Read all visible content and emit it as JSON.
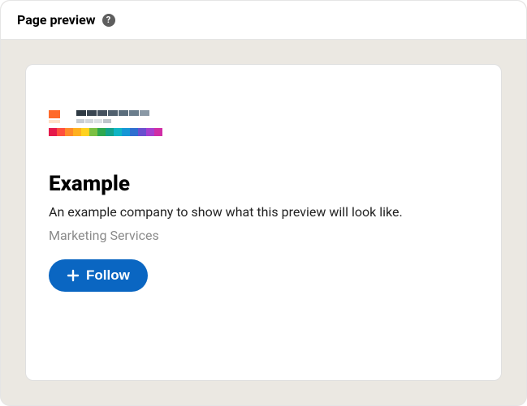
{
  "panel": {
    "title": "Page preview"
  },
  "preview": {
    "company_name": "Example",
    "tagline": "An example company to show what this preview will look like.",
    "industry": "Marketing Services",
    "follow_label": "Follow"
  },
  "logo": {
    "row1_left_a": "#ff6a2b",
    "row1_left_b": "#ffe1c8",
    "dark_palette": [
      "#2f3a44",
      "#3a4652",
      "#45525f",
      "#50606e",
      "#5a6d7c",
      "#6a7d8c",
      "#8a99a6"
    ],
    "grey_palette": [
      "#c7cdd3",
      "#d2d7dc",
      "#dde1e5",
      "#bfc5cb"
    ],
    "rainbow": [
      "#e5194b",
      "#ff4f3e",
      "#ff8a2a",
      "#ffb01f",
      "#ffd21f",
      "#7bc043",
      "#2fa84f",
      "#14a38b",
      "#0fb5c4",
      "#1597d6",
      "#2f6fd0",
      "#6a4fcf",
      "#a63fcf",
      "#d02ea6"
    ]
  }
}
